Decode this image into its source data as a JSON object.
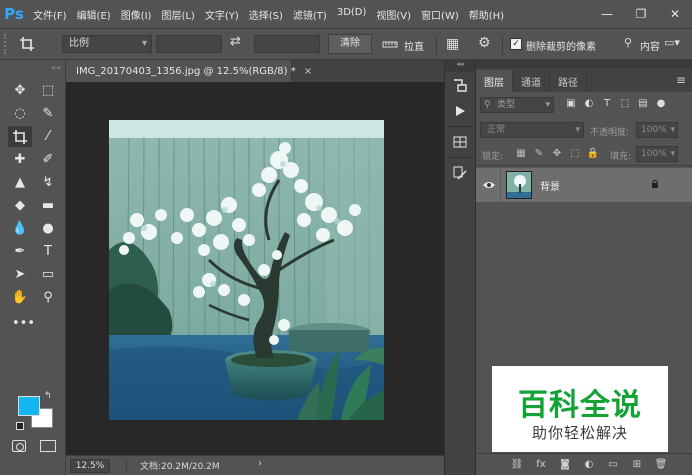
{
  "app": {
    "logo": "Ps",
    "menu": [
      "文件(F)",
      "编辑(E)",
      "图像(I)",
      "图层(L)",
      "文字(Y)",
      "选择(S)",
      "滤镜(T)",
      "3D(D)",
      "视图(V)",
      "窗口(W)",
      "帮助(H)"
    ],
    "window_controls": [
      "minimize-icon",
      "maximize-icon",
      "close-icon"
    ]
  },
  "options_bar": {
    "tool_icon": "crop-icon",
    "ratio_select": "比例",
    "ratio_arrow": "▾",
    "swap_symbol": "⇄",
    "clear_button": "清除",
    "straighten_label": "拉直",
    "delete_cropped_checked": true,
    "delete_cropped_label": "删除裁剪的像素",
    "content_aware_label": "内容",
    "icons": [
      "straighten-icon",
      "grid-overlay-icon",
      "gear-icon",
      "search-icon",
      "workspace-icon"
    ]
  },
  "toolbar": {
    "tools": [
      {
        "name": "move-tool-icon",
        "glyph": "✥"
      },
      {
        "name": "marquee-tool-icon",
        "glyph": "⬚"
      },
      {
        "name": "lasso-tool-icon",
        "glyph": "◌"
      },
      {
        "name": "quick-select-tool-icon",
        "glyph": "✎"
      },
      {
        "name": "crop-tool-icon",
        "glyph": "crop",
        "active": true
      },
      {
        "name": "eyedropper-tool-icon",
        "glyph": "⁄"
      },
      {
        "name": "healing-tool-icon",
        "glyph": "✚"
      },
      {
        "name": "brush-tool-icon",
        "glyph": "✐"
      },
      {
        "name": "stamp-tool-icon",
        "glyph": "▲"
      },
      {
        "name": "history-brush-tool-icon",
        "glyph": "↯"
      },
      {
        "name": "eraser-tool-icon",
        "glyph": "◆"
      },
      {
        "name": "gradient-tool-icon",
        "glyph": "▬"
      },
      {
        "name": "blur-tool-icon",
        "glyph": "💧"
      },
      {
        "name": "dodge-tool-icon",
        "glyph": "●"
      },
      {
        "name": "pen-tool-icon",
        "glyph": "✒"
      },
      {
        "name": "type-tool-icon",
        "glyph": "T"
      },
      {
        "name": "path-select-tool-icon",
        "glyph": "➤"
      },
      {
        "name": "shape-tool-icon",
        "glyph": "▭"
      },
      {
        "name": "hand-tool-icon",
        "glyph": "✋"
      },
      {
        "name": "zoom-tool-icon",
        "glyph": "⚲"
      }
    ],
    "more_glyph": "•••",
    "foreground_color": "#12b6f0",
    "background_color": "#ffffff",
    "swap_glyph": "↰"
  },
  "document": {
    "tab_title": "IMG_20170403_1356.jpg @ 12.5%(RGB/8) *",
    "tab_close": "×",
    "zoom": "12.5%",
    "doc_size": "文档:20.2M/20.2M",
    "status_arrow": "›"
  },
  "dock": {
    "buttons": [
      "history-icon",
      "play-actions-icon",
      "properties-icon",
      "channels-panel-icon"
    ]
  },
  "layers_panel": {
    "tabs": [
      "图层",
      "通道",
      "路径"
    ],
    "active_tab": 0,
    "menu_icon": "≡",
    "filter_label": "类型",
    "filter_icons": [
      "pixel-filter-icon",
      "adjustment-filter-icon",
      "type-filter-icon",
      "shape-filter-icon",
      "smart-object-filter-icon"
    ],
    "blend_mode": "正常",
    "opacity_label": "不透明度:",
    "opacity_value": "100%",
    "lock_label": "锁定:",
    "lock_icons": [
      "lock-transparent-icon",
      "lock-paint-icon",
      "lock-move-icon",
      "lock-artboard-icon",
      "lock-all-icon"
    ],
    "fill_label": "填充:",
    "fill_value": "100%",
    "layers": [
      {
        "name": "背景",
        "visible": true,
        "locked": true
      }
    ],
    "footer_icons": [
      "link-layers-icon",
      "fx-icon",
      "mask-icon",
      "adjustment-icon",
      "group-icon",
      "new-layer-icon",
      "trash-icon"
    ],
    "footer_glyphs": [
      "⛓",
      "fx",
      "◙",
      "◐",
      "▭",
      "⊞",
      "🗑"
    ]
  },
  "watermark": {
    "title": "百科全说",
    "subtitle": "助你轻松解决"
  },
  "colors": {
    "ui_dark": "#535353",
    "canvas_bg": "#282828",
    "accent_blue": "#31a8ff",
    "watermark_green": "#12a235"
  }
}
